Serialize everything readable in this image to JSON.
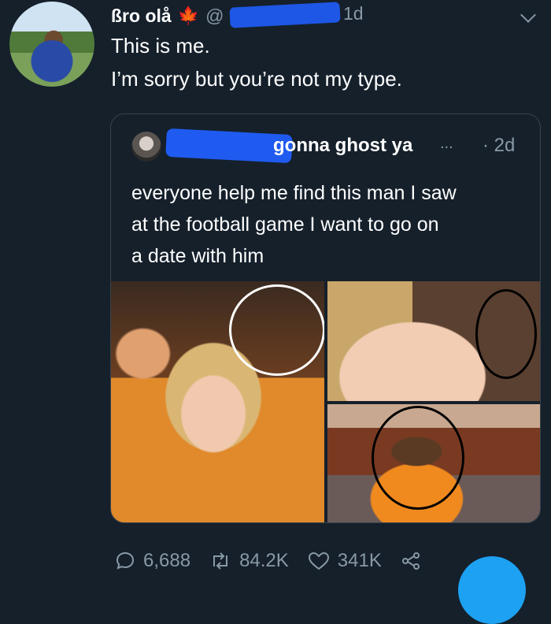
{
  "tweet": {
    "name": "ßro olå",
    "flag": "🍁",
    "handle_visible": "@",
    "time": "1d",
    "lines": [
      "This is me.",
      "I’m sorry but you’re not my type."
    ]
  },
  "quoted": {
    "name_visible": "gonna ghost ya",
    "ellipsis": "...",
    "time": "· 2d",
    "lines": [
      "everyone help me find this man I saw",
      "at the football game I want to go on",
      "a date with him"
    ]
  },
  "actions": {
    "replies": "6,688",
    "retweets": "84.2K",
    "likes": "341K"
  }
}
